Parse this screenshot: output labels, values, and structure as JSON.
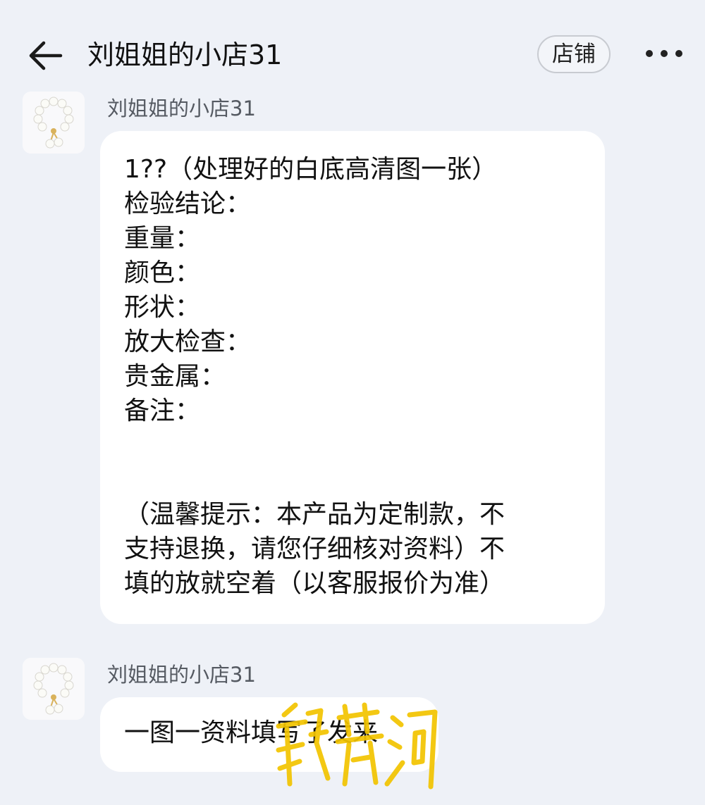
{
  "header": {
    "title": "刘姐姐的小店31",
    "shop_button_label": "店铺",
    "back_icon": "arrow-left-icon",
    "more_icon": "more-dots-icon"
  },
  "messages": [
    {
      "sender": "刘姐姐的小店31",
      "avatar_icon": "pearl-bracelet-avatar",
      "lines": [
        "1??（处理好的白底高清图一张）",
        "检验结论：",
        "重量：",
        "颜色：",
        "形状：",
        "放大检查：",
        "贵金属：",
        "备注：",
        "",
        "",
        "（温馨提示：本产品为定制款，不",
        "支持退换，请您仔细核对资料）不",
        "填的放就空着（以客服报价为准）"
      ]
    },
    {
      "sender": "刘姐姐的小店31",
      "avatar_icon": "pearl-bracelet-avatar",
      "lines": [
        "一图一资料填写了发来"
      ]
    }
  ],
  "colors": {
    "background": "#eef1f7",
    "bubble": "#ffffff",
    "watermark": "#f2c400"
  }
}
